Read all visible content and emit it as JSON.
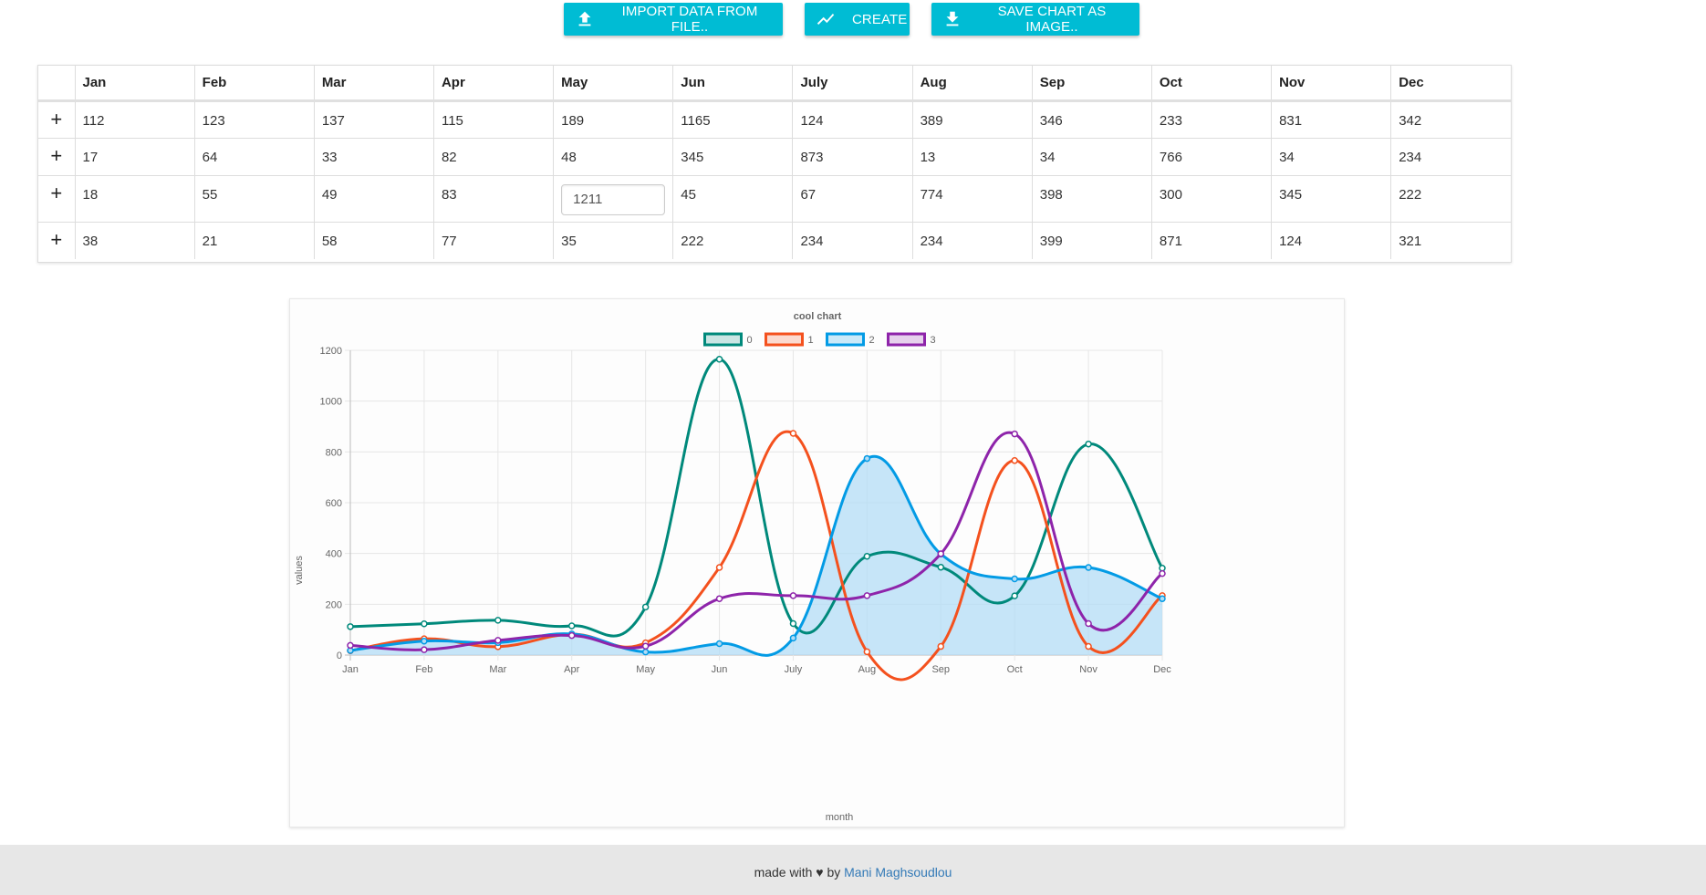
{
  "toolbar": {
    "import_label": "IMPORT DATA FROM FILE..",
    "create_label": "CREATE",
    "save_label": "SAVE CHART AS IMAGE.."
  },
  "table": {
    "headers": [
      "Jan",
      "Feb",
      "Mar",
      "Apr",
      "May",
      "Jun",
      "July",
      "Aug",
      "Sep",
      "Oct",
      "Nov",
      "Dec"
    ],
    "add_symbol": "+",
    "rows": [
      [
        "112",
        "123",
        "137",
        "115",
        "189",
        "1165",
        "124",
        "389",
        "346",
        "233",
        "831",
        "342"
      ],
      [
        "17",
        "64",
        "33",
        "82",
        "48",
        "345",
        "873",
        "13",
        "34",
        "766",
        "34",
        "234"
      ],
      [
        "18",
        "55",
        "49",
        "83",
        "1211",
        "45",
        "67",
        "774",
        "398",
        "300",
        "345",
        "222"
      ],
      [
        "38",
        "21",
        "58",
        "77",
        "35",
        "222",
        "234",
        "234",
        "399",
        "871",
        "124",
        "321"
      ]
    ],
    "editing": {
      "row": 2,
      "col": 4,
      "value": "1211"
    }
  },
  "chart_data": {
    "type": "line",
    "title": "cool chart",
    "xlabel": "month",
    "ylabel": "values",
    "categories": [
      "Jan",
      "Feb",
      "Mar",
      "Apr",
      "May",
      "Jun",
      "July",
      "Aug",
      "Sep",
      "Oct",
      "Nov",
      "Dec"
    ],
    "ylim": [
      0,
      1200
    ],
    "yticks": [
      0,
      200,
      400,
      600,
      800,
      1000,
      1200
    ],
    "grid": true,
    "legend_position": "top",
    "series": [
      {
        "name": "0",
        "color": "#00897b",
        "fill": false,
        "values": [
          112,
          123,
          137,
          115,
          189,
          1165,
          124,
          389,
          346,
          233,
          831,
          342
        ]
      },
      {
        "name": "1",
        "color": "#f4511e",
        "fill": false,
        "values": [
          17,
          64,
          33,
          82,
          48,
          345,
          873,
          13,
          34,
          766,
          34,
          234
        ]
      },
      {
        "name": "2",
        "color": "#039be5",
        "fill": true,
        "fill_color": "#b3dcf5",
        "values": [
          18,
          55,
          49,
          83,
          12,
          45,
          67,
          774,
          398,
          300,
          345,
          222
        ]
      },
      {
        "name": "3",
        "color": "#8e24aa",
        "fill": false,
        "values": [
          38,
          21,
          58,
          77,
          35,
          222,
          234,
          234,
          399,
          871,
          124,
          321
        ]
      }
    ]
  },
  "footer": {
    "text": "made with ♥ by",
    "author": "Mani Maghsoudlou"
  }
}
